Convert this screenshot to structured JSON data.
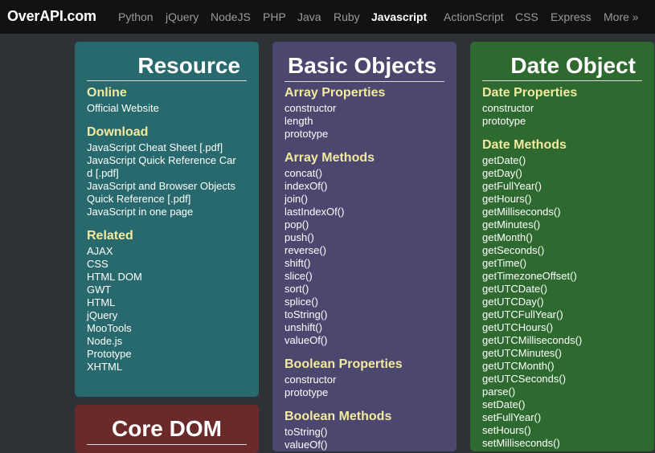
{
  "logo": "OverAPI.com",
  "nav": [
    "Python",
    "jQuery",
    "NodeJS",
    "PHP",
    "Java",
    "Ruby",
    "Javascript",
    "ActionScript",
    "CSS",
    "Express",
    "More »"
  ],
  "panels": {
    "resource": {
      "title": "Resource",
      "online": {
        "heading": "Online",
        "items": [
          "Official Website"
        ]
      },
      "download": {
        "heading": "Download",
        "items": [
          "JavaScript Cheat Sheet [.pdf]",
          "JavaScript Quick Reference Car",
          "d [.pdf]",
          "JavaScript and Browser Objects",
          "Quick Reference [.pdf]",
          "JavaScript in one page"
        ]
      },
      "related": {
        "heading": "Related",
        "items": [
          "AJAX",
          "CSS",
          "HTML DOM",
          "GWT",
          "HTML",
          "jQuery",
          "MooTools",
          "Node.js",
          "Prototype",
          "XHTML"
        ]
      }
    },
    "basic_objects": {
      "title": "Basic Objects",
      "array_properties": {
        "heading": "Array Properties",
        "items": [
          "constructor",
          "length",
          "prototype"
        ]
      },
      "array_methods": {
        "heading": "Array Methods",
        "items": [
          "concat()",
          "indexOf()",
          "join()",
          "lastIndexOf()",
          "pop()",
          "push()",
          "reverse()",
          "shift()",
          "slice()",
          "sort()",
          "splice()",
          "toString()",
          "unshift()",
          "valueOf()"
        ]
      },
      "boolean_properties": {
        "heading": "Boolean Properties",
        "items": [
          "constructor",
          "prototype"
        ]
      },
      "boolean_methods": {
        "heading": "Boolean Methods",
        "items": [
          "toString()",
          "valueOf()"
        ]
      }
    },
    "date_object": {
      "title": "Date Object",
      "date_properties": {
        "heading": "Date Properties",
        "items": [
          "constructor",
          "prototype"
        ]
      },
      "date_methods": {
        "heading": "Date Methods",
        "items": [
          "getDate()",
          "getDay()",
          "getFullYear()",
          "getHours()",
          "getMilliseconds()",
          "getMinutes()",
          "getMonth()",
          "getSeconds()",
          "getTime()",
          "getTimezoneOffset()",
          "getUTCDate()",
          "getUTCDay()",
          "getUTCFullYear()",
          "getUTCHours()",
          "getUTCMilliseconds()",
          "getUTCMinutes()",
          "getUTCMonth()",
          "getUTCSeconds()",
          "parse()",
          "setDate()",
          "setFullYear()",
          "setHours()",
          "setMilliseconds()"
        ]
      }
    },
    "core_dom": {
      "title": "Core DOM"
    }
  }
}
